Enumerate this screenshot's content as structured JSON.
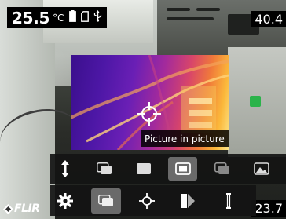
{
  "status": {
    "spot_temperature": "25.5",
    "unit": "°C",
    "icons": [
      "battery-icon",
      "sd-card-icon",
      "usb-icon"
    ]
  },
  "scale": {
    "max": "40.4",
    "min": "23.7"
  },
  "tooltip": {
    "text": "Picture in picture"
  },
  "toolbar_top": {
    "items": [
      {
        "icon": "collapse-arrows-icon"
      },
      {
        "icon": "thermal-msx-icon"
      },
      {
        "icon": "thermal-icon"
      },
      {
        "icon": "picture-in-picture-icon",
        "selected": true
      },
      {
        "icon": "thermal-blending-icon"
      },
      {
        "icon": "digital-camera-icon"
      }
    ]
  },
  "toolbar_bottom": {
    "items": [
      {
        "icon": "settings-gear-icon"
      },
      {
        "icon": "image-mode-icon",
        "selected": true
      },
      {
        "icon": "measurement-spot-icon"
      },
      {
        "icon": "color-palette-icon"
      },
      {
        "icon": "temperature-scale-icon"
      }
    ]
  },
  "brand": {
    "logo": "FLIR"
  },
  "colors": {
    "toolbar_bg": "#141414",
    "selected_bg": "#6a6a6a",
    "thermal_cold": "#3a0f8c",
    "thermal_hot": "#fde68a"
  }
}
